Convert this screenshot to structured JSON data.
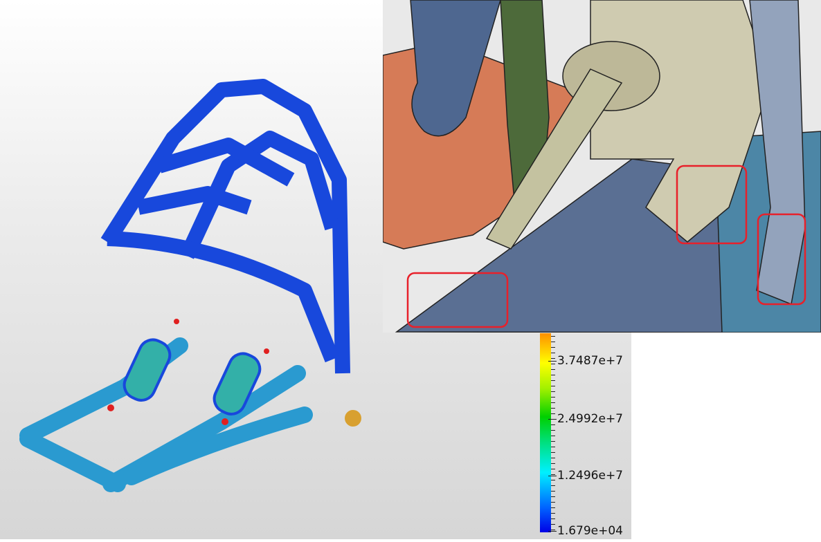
{
  "legend": {
    "labels": [
      "3.7487e+7",
      "2.4992e+7",
      "1.2496e+7",
      "1.679e+04"
    ],
    "colors": {
      "min": "#0000e6",
      "mid": "#00d000",
      "max": "#ff9000"
    }
  },
  "colors": {
    "highlight": "#e8202a",
    "orange_part": "#d67b57",
    "green_part": "#4d6a3a",
    "beige_part": "#cfcbb0",
    "blue_part": "#5a6f93",
    "teal_part": "#4c86a6"
  }
}
